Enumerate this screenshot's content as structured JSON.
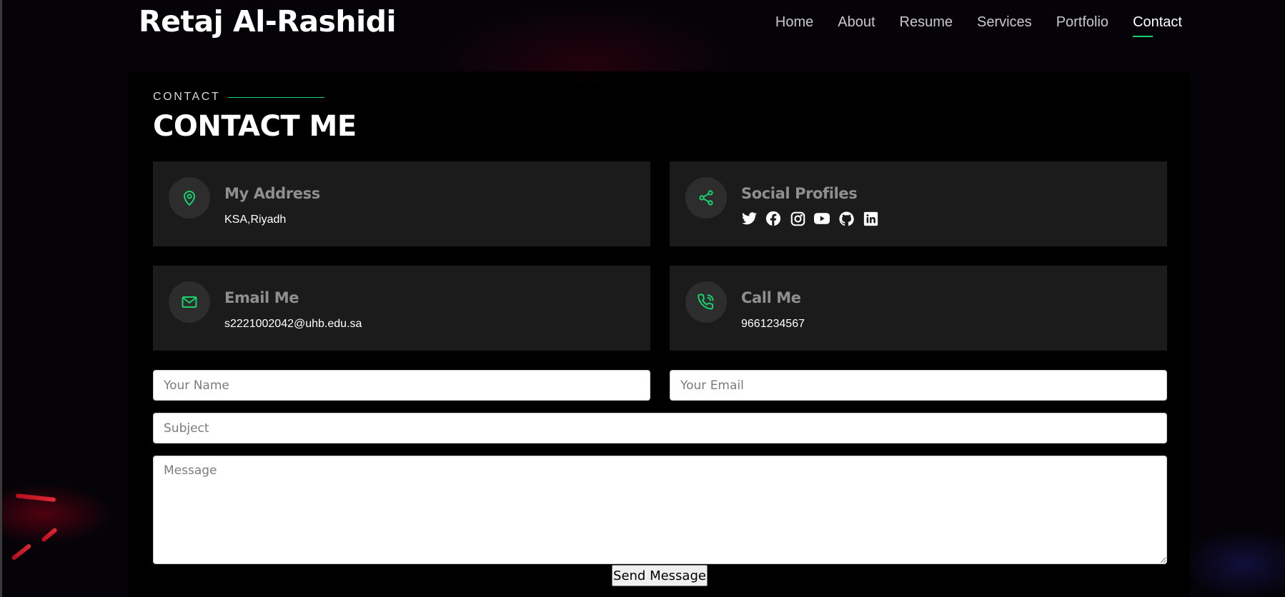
{
  "site": {
    "name": "Retaj Al-Rashidi"
  },
  "nav": {
    "items": [
      {
        "label": "Home",
        "active": false
      },
      {
        "label": "About",
        "active": false
      },
      {
        "label": "Resume",
        "active": false
      },
      {
        "label": "Services",
        "active": false
      },
      {
        "label": "Portfolio",
        "active": false
      },
      {
        "label": "Contact",
        "active": true
      }
    ]
  },
  "section": {
    "label": "CONTACT",
    "title": "CONTACT ME"
  },
  "cards": {
    "address": {
      "title": "My Address",
      "text": "KSA,Riyadh",
      "icon": "map-pin-icon"
    },
    "social": {
      "title": "Social Profiles",
      "icon": "share-icon",
      "links": [
        "twitter-icon",
        "facebook-icon",
        "instagram-icon",
        "youtube-icon",
        "github-icon",
        "linkedin-icon"
      ]
    },
    "email": {
      "title": "Email Me",
      "text": "s2221002042@uhb.edu.sa",
      "icon": "envelope-icon"
    },
    "phone": {
      "title": "Call Me",
      "text": "9661234567",
      "icon": "phone-icon"
    }
  },
  "form": {
    "name_placeholder": "Your Name",
    "email_placeholder": "Your Email",
    "subject_placeholder": "Subject",
    "message_placeholder": "Message",
    "submit_label": "Send Message"
  },
  "colors": {
    "accent": "#18d26e",
    "card_bg": "#1b1b1b",
    "page_bg": "#050308"
  }
}
